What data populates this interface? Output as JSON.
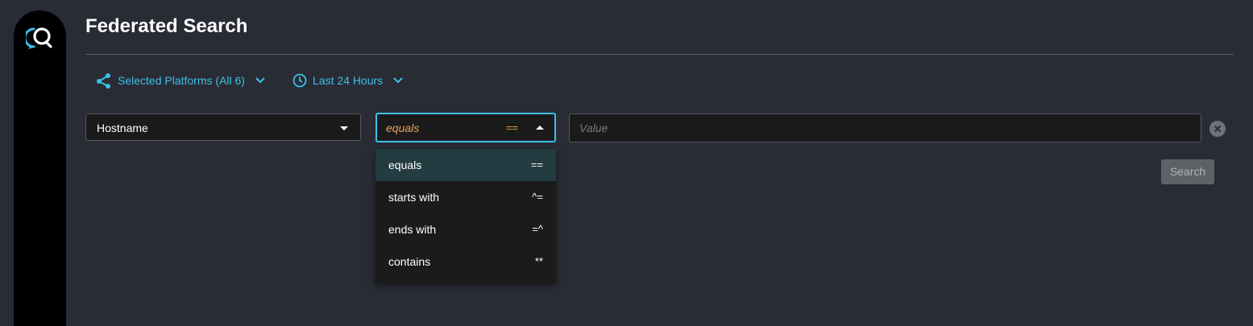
{
  "page": {
    "title": "Federated Search"
  },
  "filters": {
    "platforms_label": "Selected Platforms (All 6)",
    "time_label": "Last 24 Hours"
  },
  "query": {
    "field": "Hostname",
    "operator": {
      "label": "equals",
      "symbol": "=="
    },
    "value_placeholder": "Value"
  },
  "operator_options": [
    {
      "label": "equals",
      "symbol": "==",
      "selected": true
    },
    {
      "label": "starts with",
      "symbol": "^="
    },
    {
      "label": "ends with",
      "symbol": "=^"
    },
    {
      "label": "contains",
      "symbol": "**"
    }
  ],
  "actions": {
    "search_label": "Search"
  },
  "colors": {
    "accent": "#3cc0e8",
    "operator_text": "#e8a35a",
    "background": "#292c35",
    "sidebar": "#000000",
    "selected_option": "#233c41"
  }
}
